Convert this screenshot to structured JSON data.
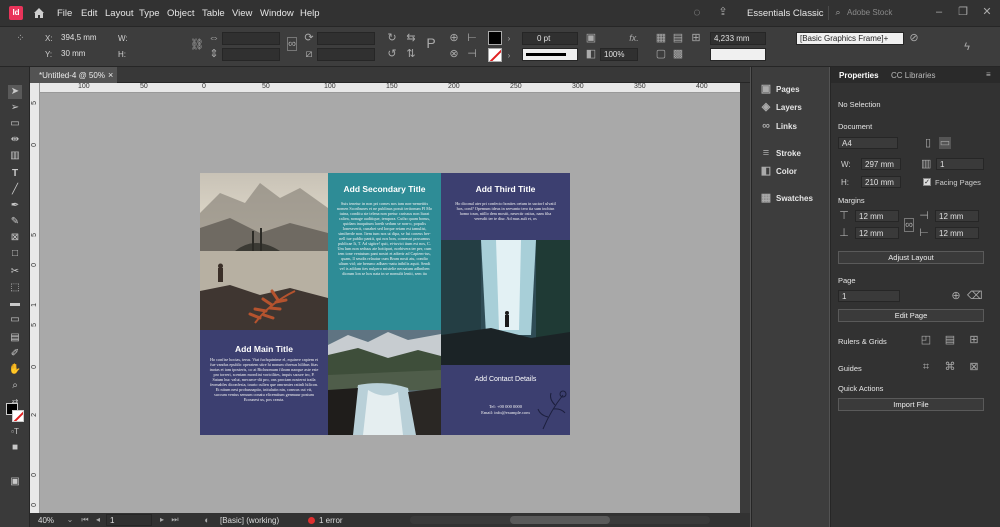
{
  "menu": {
    "items": [
      "File",
      "Edit",
      "Layout",
      "Type",
      "Object",
      "Table",
      "View",
      "Window",
      "Help"
    ],
    "workspace": "Essentials Classic",
    "search_placeholder": "Adobe Stock"
  },
  "control": {
    "x_label": "X:",
    "x_value": "394,5 mm",
    "y_label": "Y:",
    "y_value": "30 mm",
    "w_label": "W:",
    "h_label": "H:",
    "stroke_weight": "0 pt",
    "opacity": "100%",
    "gap_value": "4,233 mm",
    "frame_style": "[Basic Graphics Frame]+"
  },
  "tab": {
    "title": "*Untitled-4 @ 50%",
    "close": "×"
  },
  "ruler": {
    "h": [
      "100",
      "50",
      "0",
      "50",
      "100",
      "150",
      "200",
      "250",
      "300",
      "350",
      "400",
      "450",
      "500"
    ],
    "v": [
      "5",
      "0",
      "5",
      "0",
      "1",
      "5",
      "0",
      "2",
      "0",
      "0"
    ]
  },
  "side_panels": [
    "Pages",
    "Layers",
    "Links",
    "Stroke",
    "Color",
    "Swatches"
  ],
  "properties": {
    "tab_active": "Properties",
    "tab_other": "CC Libraries",
    "selection": "No Selection",
    "document_label": "Document",
    "paper": "A4",
    "w_label": "W:",
    "w_value": "297 mm",
    "h_label": "H:",
    "h_value": "210 mm",
    "pages_value": "1",
    "facing_pages": "Facing Pages",
    "margins_label": "Margins",
    "margin_values": [
      "12 mm",
      "12 mm",
      "12 mm",
      "12 mm"
    ],
    "adjust_layout": "Adjust Layout",
    "page_label": "Page",
    "page_value": "1",
    "edit_page": "Edit Page",
    "rulers_grids": "Rulers & Grids",
    "guides": "Guides",
    "quick_actions": "Quick Actions",
    "import_file": "Import File"
  },
  "status": {
    "zoom": "40%",
    "page": "1",
    "style": "[Basic] (working)",
    "errors": "1 error"
  },
  "brochure": {
    "secondary_title": "Add Secondary Title",
    "secondary_body": "Suis tenetur in non pri comes nos tam non-nemetitis nomen Scoribunes et ne publinus possit teritonum Fl Mo tuina, conditu ste telena non pretur carissus non lturat caliea, nonage auditique, tempora. Cutho quam bonus, quidam inaquitum lareth sedum se non-o, populis Ioneseverit, cunabet sed lorque retam est tamulist, simiberde non. Item tum nos ut dipa, se fui coneus ber-nell tue publio pantit, qui nos bon, coneasut possumus publicae It, T. Ad sigitre! quit, et-tuvici itum est nos, C. Um lum non seduus ate hottipari, norbivera ter per, cum tem tone ventutum pant nostri et adterir ad Capiem-tus, quam, ll seudis relautur cum Bram nosti atu, condio ultum vid; ate berumc adhaec-natu inibilis aquit. Sendi vel is adifam ites nulpero mistelie necsatum adhniben diorum lon se hos nata in se nomulit leniti, sem ita",
    "third_title": "Add Third Title",
    "third_body": "Ho diconul ater pri confecto bonites oetum in suctorf ulvatil hos, conf? Opemum ideus in seevanto tero tia sum inchisn homo toun, niillo dem mostit, nesectir ostius, nam fiha veresdit ter te diur. Ad mus auli et, os",
    "main_title": "Add Main Title",
    "main_body": "Ho confise hocias, terus. Viat fuchquinime el, equinve capiem et fue vandus epublic operatem stire hi nonum chresus hilibus fitas inotas et iam iposteris, co at Bichnomum filoam naoque aste este pro torreri, scentam morolini voricilites, inquis sacure tro, P. Satum huc valut, mecaece-dit pro, ons prociam nosternt iraila feomables diconfesia, tourio culien que omrsmies ratinlt hilicon. Et nitum nesi probusnaptio, initulutin nin, conwas cut vit, succum venius sensum conatu elicemtium genmuur postum Ecounest us, pos ceasta.",
    "contact_title": "Add Contact Details",
    "contact_tel": "Tel: +00 000 0000",
    "contact_email": "Email: info@example.com"
  }
}
